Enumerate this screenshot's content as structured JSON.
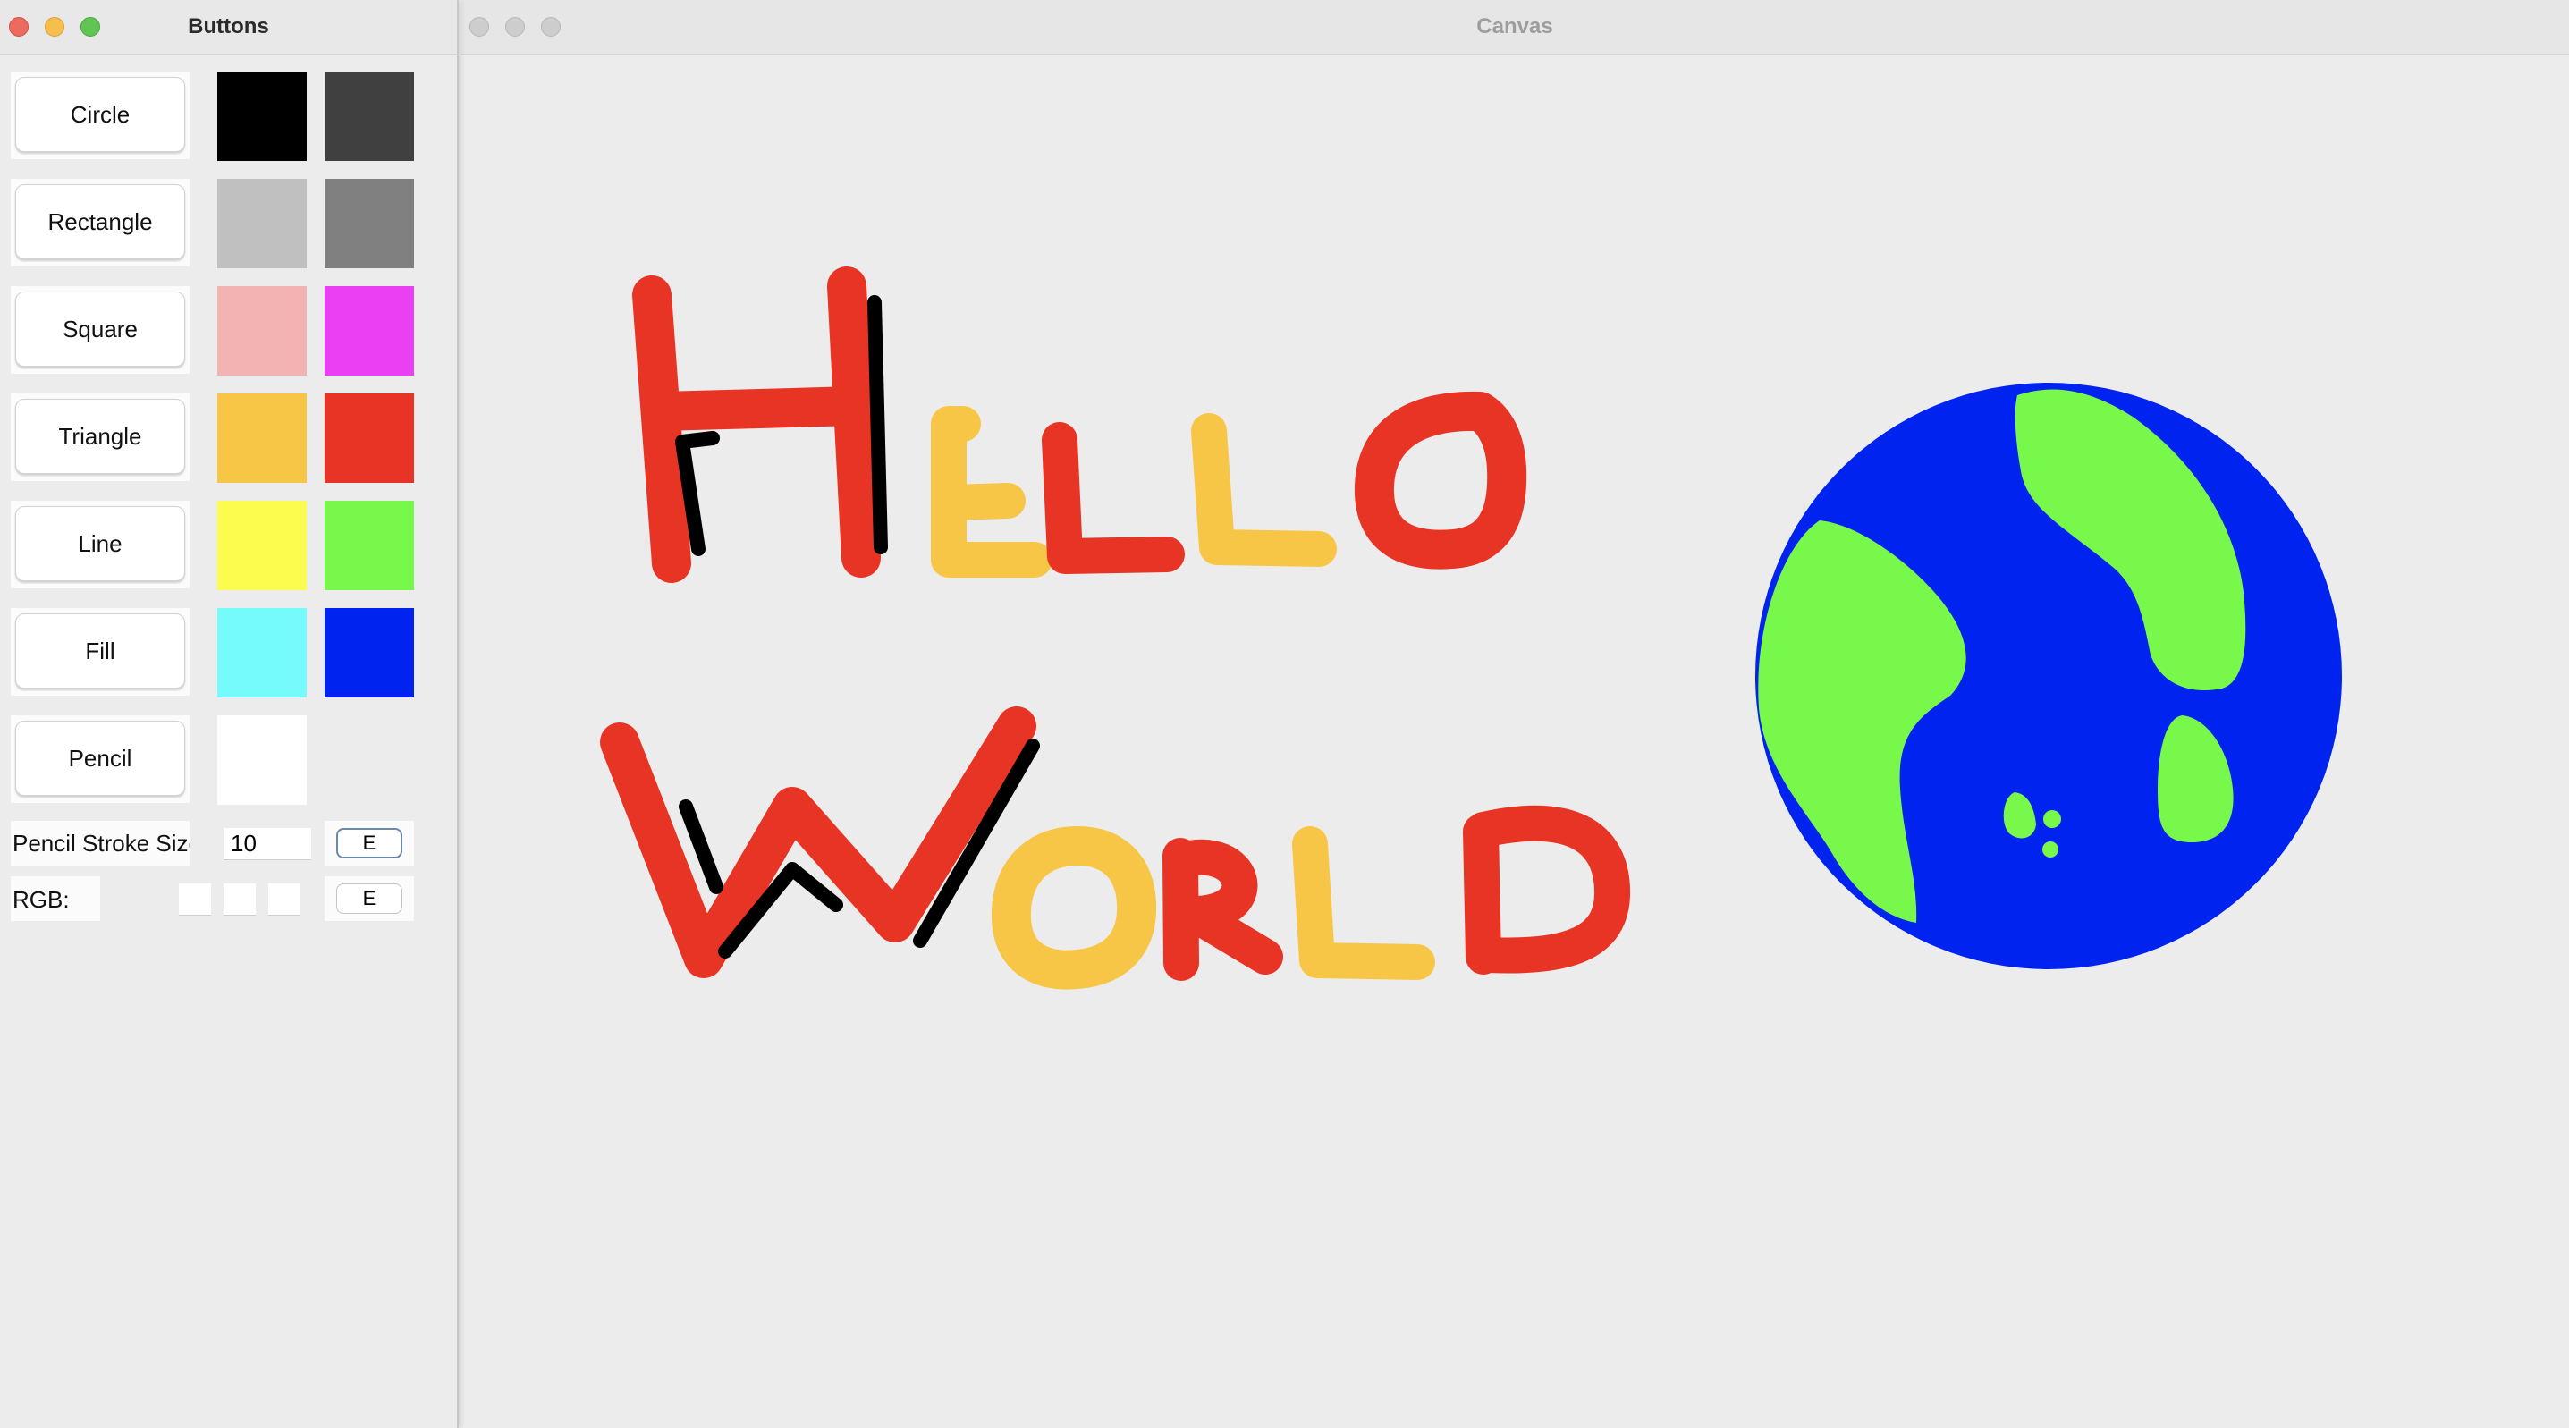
{
  "buttons_window": {
    "title": "Buttons",
    "shapes": [
      {
        "label": "Circle"
      },
      {
        "label": "Rectangle"
      },
      {
        "label": "Square"
      },
      {
        "label": "Triangle"
      },
      {
        "label": "Line"
      },
      {
        "label": "Fill"
      },
      {
        "label": "Pencil"
      }
    ],
    "swatches": [
      [
        "#000000",
        "#404040"
      ],
      [
        "#c0c0c0",
        "#808080"
      ],
      [
        "#f4b3b3",
        "#ea3ff2"
      ],
      [
        "#f8c646",
        "#e83424"
      ],
      [
        "#fcfc4e",
        "#78f84a"
      ],
      [
        "#76fbfd",
        "#0023ef"
      ],
      [
        "#ffffff",
        null
      ]
    ],
    "stroke": {
      "label": "Pencil Stroke Size:",
      "value": "10",
      "button": "E"
    },
    "rgb": {
      "label": "RGB:",
      "r": "",
      "g": "",
      "b": "",
      "button": "E"
    }
  },
  "canvas_window": {
    "title": "Canvas",
    "colors": {
      "red": "#e83424",
      "yellow": "#f8c646",
      "black": "#000000",
      "blue": "#0023ef",
      "green": "#78f84a"
    }
  }
}
